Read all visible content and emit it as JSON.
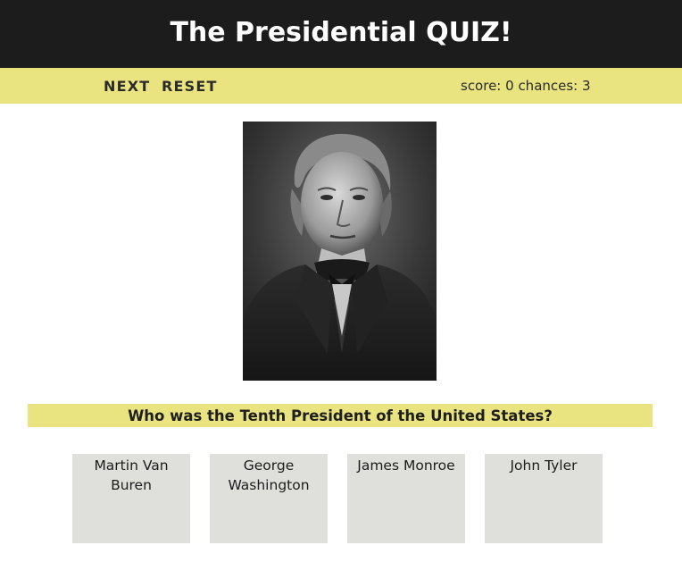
{
  "header": {
    "title": "The Presidential QUIZ!"
  },
  "toolbar": {
    "next_label": "NEXT",
    "reset_label": "RESET",
    "score_text": "score: 0 chances: 3"
  },
  "question": "Who was the Tenth President of the United States?",
  "answers": [
    {
      "label": "Martin Van Buren"
    },
    {
      "label": "George Washington"
    },
    {
      "label": "James Monroe"
    },
    {
      "label": "John Tyler"
    }
  ],
  "colors": {
    "header_bg": "#1c1c1c",
    "accent_yellow": "#e9e47f",
    "answer_bg": "#dfe0db"
  }
}
